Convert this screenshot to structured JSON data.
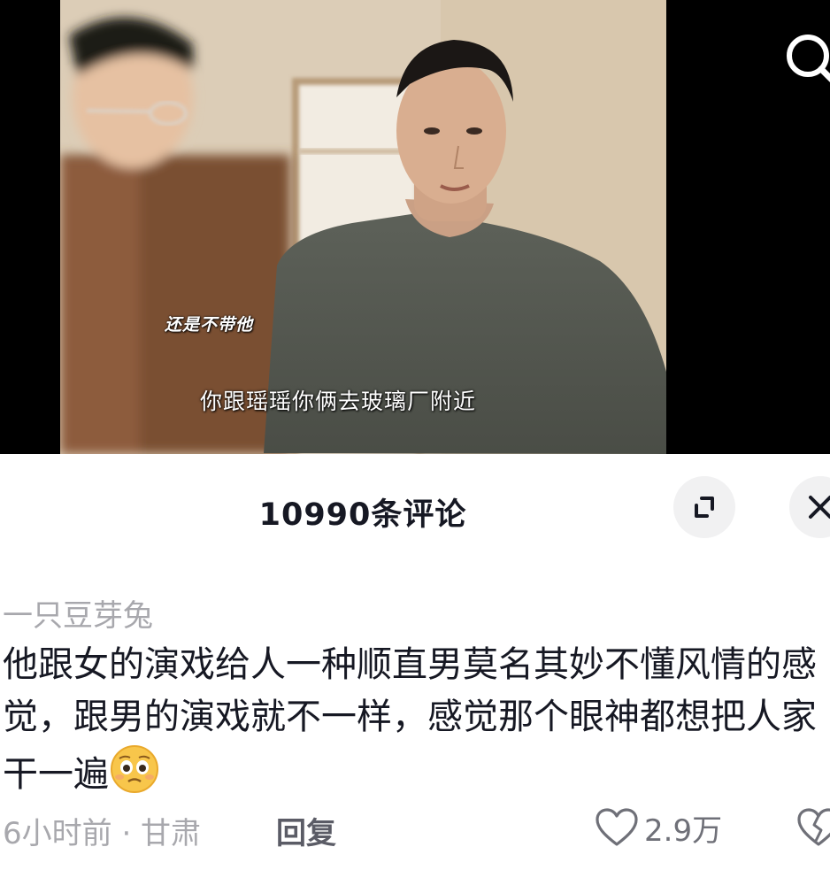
{
  "video": {
    "subtitle_top": "还是不带他",
    "subtitle_main": "你跟瑶瑶你俩去玻璃厂附近"
  },
  "toolbar": {
    "search_icon": "search-icon"
  },
  "comments": {
    "count_label": "10990条评论",
    "expand_icon": "expand-icon",
    "close_icon": "close-icon"
  },
  "comment": {
    "username": "一只豆芽兔",
    "text": "他跟女的演戏给人一种顺直男莫名其妙不懂风情的感觉，跟男的演戏就不一样，感觉那个眼神都想把人家干一遍",
    "emoji": "pleading-face-emoji",
    "meta": "6小时前 · 甘肃",
    "reply_label": "回复",
    "like_count": "2.9万",
    "like_icon": "heart-icon",
    "dislike_icon": "broken-heart-icon"
  },
  "colors": {
    "primary_text": "#161823",
    "secondary_text": "#a8a8ad",
    "button_bg": "#f1f1f2"
  }
}
